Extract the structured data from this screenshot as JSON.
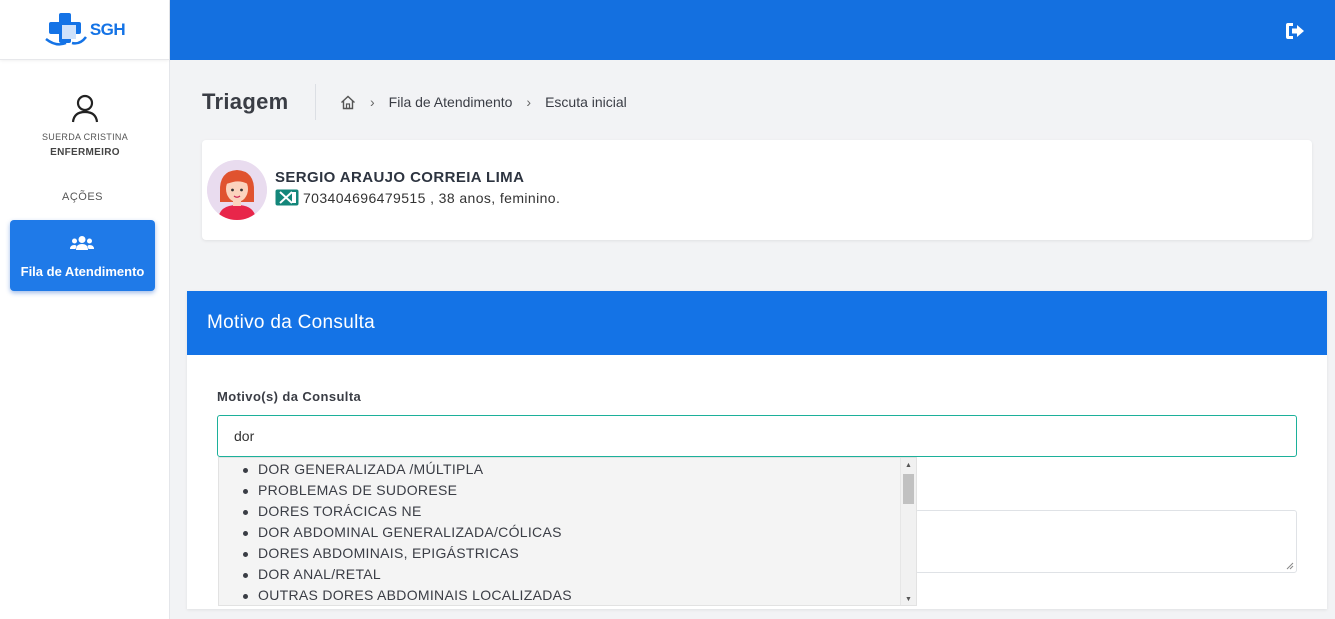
{
  "logo": {
    "text": "SGH",
    "brand_color": "#1473e6"
  },
  "header": {
    "bg_color": "#1470e0",
    "logout_icon": "sign-out-icon"
  },
  "user": {
    "name": "SUERDA CRISTINA",
    "role": "ENFERMEIRO"
  },
  "sidebar": {
    "section_label": "AÇÕES",
    "items": [
      {
        "label": "Fila de Atendimento",
        "icon": "users-icon",
        "active": true
      }
    ]
  },
  "page": {
    "title": "Triagem",
    "breadcrumb": [
      "Fila de Atendimento",
      "Escuta inicial"
    ]
  },
  "patient": {
    "name": "SERGIO ARAUJO CORREIA LIMA",
    "info": "703404696479515 , 38 anos, feminino."
  },
  "motivo": {
    "panel_title": "Motivo da Consulta",
    "field_label": "Motivo(s) da Consulta",
    "search_value": "dor",
    "suggestions": [
      "DOR GENERALIZADA /MÚLTIPLA",
      "PROBLEMAS DE SUDORESE",
      "DORES TORÁCICAS NE",
      "DOR ABDOMINAL GENERALIZADA/CÓLICAS",
      "DORES ABDOMINAIS, EPIGÁSTRICAS",
      "DOR ANAL/RETAL",
      "OUTRAS DORES ABDOMINAIS LOCALIZADAS"
    ]
  }
}
